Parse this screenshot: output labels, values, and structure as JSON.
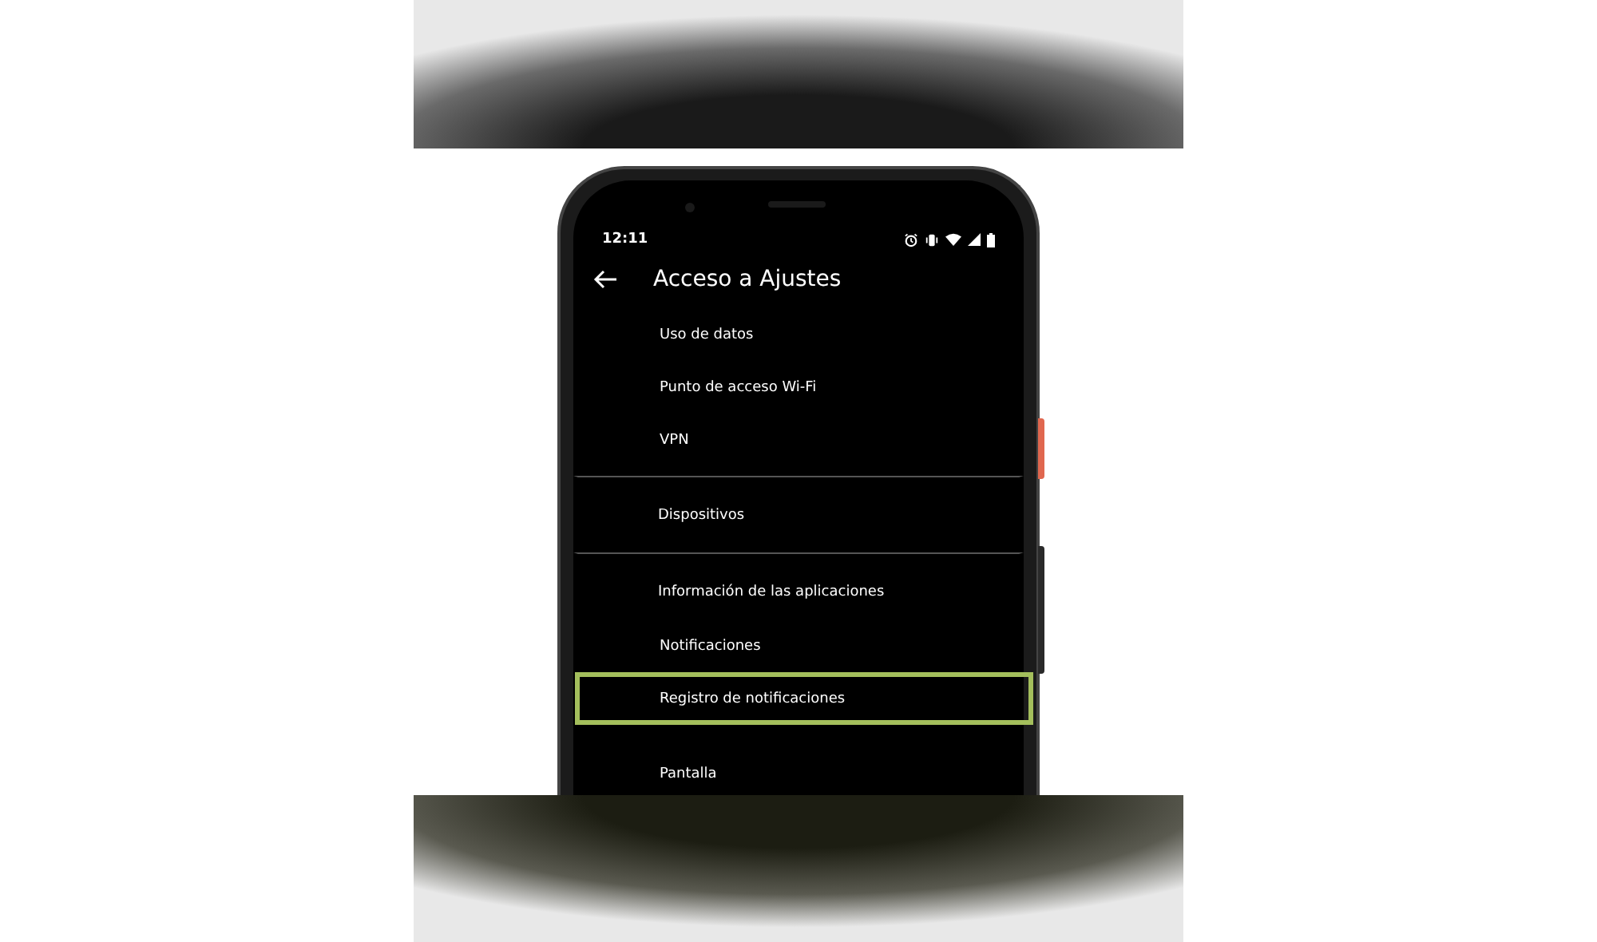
{
  "status_bar": {
    "time": "12:11"
  },
  "app_bar": {
    "title": "Acceso a Ajustes"
  },
  "groups": [
    {
      "divider": false,
      "items": [
        {
          "label": "Uso de datos",
          "highlighted": false
        },
        {
          "label": "Punto de acceso Wi-Fi",
          "highlighted": false
        },
        {
          "label": "VPN",
          "highlighted": false
        }
      ]
    },
    {
      "divider": true,
      "items": [
        {
          "label": "Dispositivos",
          "highlighted": false
        }
      ]
    },
    {
      "divider": true,
      "items": [
        {
          "label": "Información de las aplicaciones",
          "highlighted": false
        },
        {
          "label": "Notificaciones",
          "highlighted": false
        },
        {
          "label": "Registro de notificaciones",
          "highlighted": true
        }
      ]
    },
    {
      "divider": false,
      "items": [
        {
          "label": "Pantalla",
          "highlighted": false
        }
      ]
    }
  ]
}
